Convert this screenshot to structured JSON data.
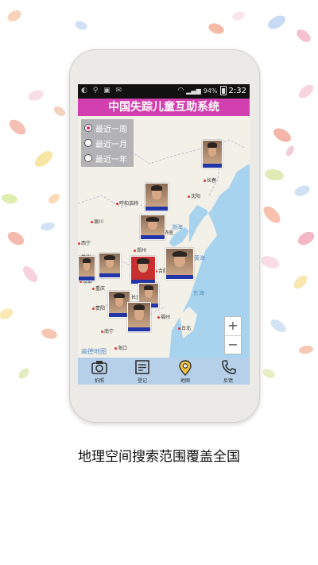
{
  "status_bar": {
    "battery": "94%",
    "time": "2:32"
  },
  "app": {
    "title": "中国失踪儿童互助系统"
  },
  "filter": {
    "options": [
      "最近一周",
      "最近一月",
      "最近一年"
    ],
    "selected_index": 0
  },
  "map": {
    "cities": [
      "长春",
      "呼和浩特",
      "沈阳",
      "银川",
      "北京",
      "西宁",
      "济南",
      "兰州",
      "西安",
      "郑州",
      "合肥",
      "成都",
      "重庆",
      "长沙",
      "贵阳",
      "福州",
      "台北",
      "南宁",
      "海口"
    ],
    "seas": [
      "渤海",
      "黄海",
      "东海"
    ],
    "attribution": "高德地图",
    "zoom_in": "+",
    "zoom_out": "−"
  },
  "nav": [
    {
      "label": "拍照",
      "icon": "camera-icon"
    },
    {
      "label": "登记",
      "icon": "register-icon"
    },
    {
      "label": "地图",
      "icon": "map-pin-icon"
    },
    {
      "label": "反馈",
      "icon": "phone-icon"
    }
  ],
  "caption": "地理空间搜索范围覆盖全国"
}
